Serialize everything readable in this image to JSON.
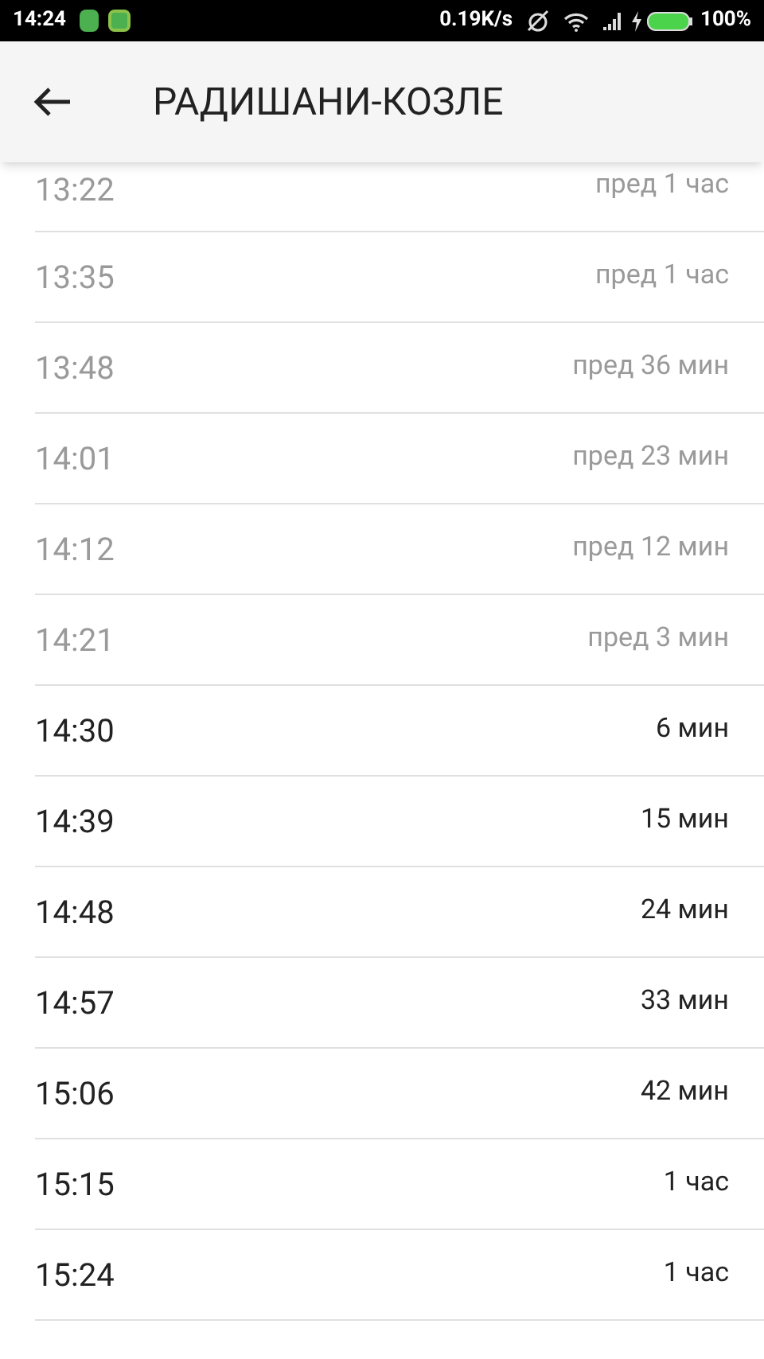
{
  "status_bar": {
    "time": "14:24",
    "speed": "0.19K/s",
    "battery": "100%"
  },
  "header": {
    "title": "РАДИШАНИ-КОЗЛЕ"
  },
  "departures": [
    {
      "time": "13:22",
      "eta": "пред 1 час",
      "past": true
    },
    {
      "time": "13:35",
      "eta": "пред 1 час",
      "past": true
    },
    {
      "time": "13:48",
      "eta": "пред 36 мин",
      "past": true
    },
    {
      "time": "14:01",
      "eta": "пред 23 мин",
      "past": true
    },
    {
      "time": "14:12",
      "eta": "пред 12 мин",
      "past": true
    },
    {
      "time": "14:21",
      "eta": "пред 3 мин",
      "past": true
    },
    {
      "time": "14:30",
      "eta": "6 мин",
      "past": false
    },
    {
      "time": "14:39",
      "eta": "15 мин",
      "past": false
    },
    {
      "time": "14:48",
      "eta": "24 мин",
      "past": false
    },
    {
      "time": "14:57",
      "eta": "33 мин",
      "past": false
    },
    {
      "time": "15:06",
      "eta": "42 мин",
      "past": false
    },
    {
      "time": "15:15",
      "eta": "1 час",
      "past": false
    },
    {
      "time": "15:24",
      "eta": "1 час",
      "past": false
    }
  ]
}
